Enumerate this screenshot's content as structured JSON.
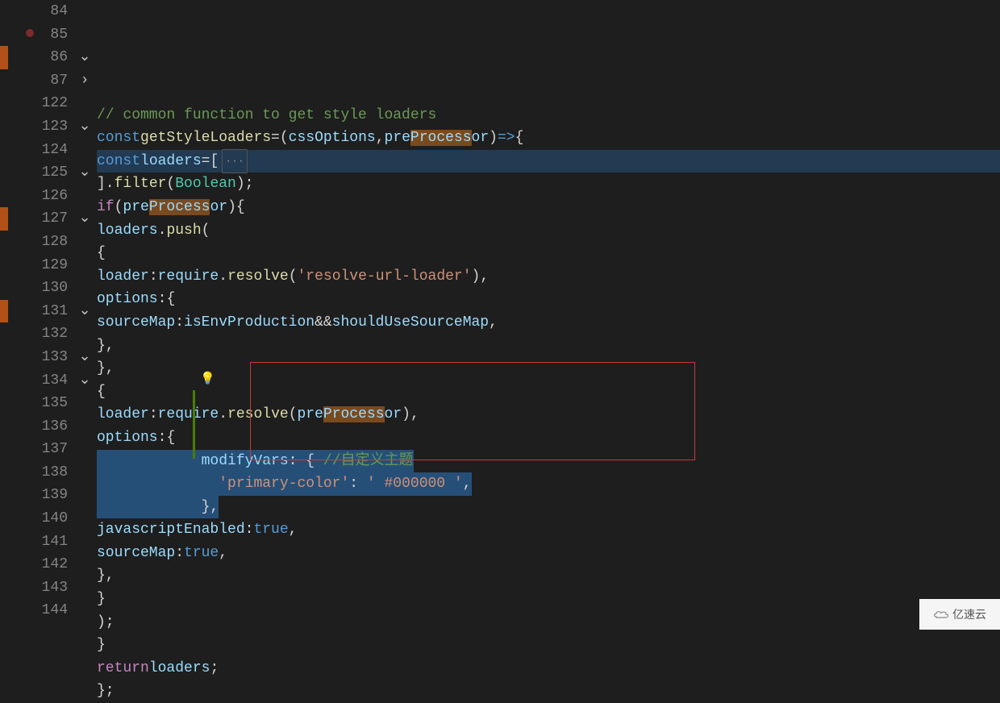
{
  "lines": [
    {
      "num": "84",
      "fold": "",
      "html": ""
    },
    {
      "num": "85",
      "fold": "",
      "html": "  <span class='cmt'>// common function to get style loaders</span>",
      "breakpoint": true
    },
    {
      "num": "86",
      "fold": "down",
      "html": "  <span class='kw'>const</span> <span class='fn'>getStyleLoaders</span> <span class='op'>=</span> <span class='punct'>(</span><span class='var'>cssOptions</span><span class='punct'>,</span> <span class='var'>pre<span class='match'>Process</span>or</span><span class='punct'>)</span> <span class='kw'>=&gt;</span> <span class='punct'>{</span>"
    },
    {
      "num": "87",
      "fold": "right",
      "html": "    <span class='kw'>const</span> <span class='var'>loaders</span> <span class='op'>=</span> <span class='punct'>[</span><span class='ellipsis'>···</span>",
      "highlight": true
    },
    {
      "num": "122",
      "fold": "",
      "html": "    <span class='punct'>].</span><span class='fn'>filter</span><span class='punct'>(</span><span class='cls'>Boolean</span><span class='punct'>);</span>"
    },
    {
      "num": "123",
      "fold": "down",
      "html": "    <span class='kw2'>if</span> <span class='punct'>(</span><span class='var'>pre<span class='match'>Process</span>or</span><span class='punct'>)</span> <span class='punct'>{</span>"
    },
    {
      "num": "124",
      "fold": "",
      "html": "      <span class='var'>loaders</span><span class='punct'>.</span><span class='fn'>push</span><span class='punct'>(</span>"
    },
    {
      "num": "125",
      "fold": "down",
      "html": "        <span class='punct'>{</span>"
    },
    {
      "num": "126",
      "fold": "",
      "html": "          <span class='var'>loader</span><span class='punct'>:</span> <span class='var'>require</span><span class='punct'>.</span><span class='fn'>resolve</span><span class='punct'>(</span><span class='str'>'resolve-url-loader'</span><span class='punct'>),</span>"
    },
    {
      "num": "127",
      "fold": "down",
      "html": "          <span class='var'>options</span><span class='punct'>:</span> <span class='punct'>{</span>"
    },
    {
      "num": "128",
      "fold": "",
      "html": "            <span class='var'>sourceMap</span><span class='punct'>:</span> <span class='var'>isEnvProduction</span> <span class='op'>&amp;&amp;</span> <span class='var'>shouldUseSourceMap</span><span class='punct'>,</span>"
    },
    {
      "num": "129",
      "fold": "",
      "html": "          <span class='punct'>},</span>"
    },
    {
      "num": "130",
      "fold": "",
      "html": "        <span class='punct'>},</span>"
    },
    {
      "num": "131",
      "fold": "down",
      "html": "        <span class='punct'>{</span>"
    },
    {
      "num": "132",
      "fold": "",
      "html": "          <span class='var'>loader</span><span class='punct'>:</span> <span class='var'>require</span><span class='punct'>.</span><span class='fn'>resolve</span><span class='punct'>(</span><span class='var'>pre<span class='match'>Process</span>or</span><span class='punct'>),</span>"
    },
    {
      "num": "133",
      "fold": "down",
      "html": "          <span class='var'>options</span><span class='punct'>:</span> <span class='punct'>{</span>"
    },
    {
      "num": "134",
      "fold": "down",
      "html": "<span class='sel'>            <span class='var'>modifyVars</span><span class='punct'>:</span> <span class='punct'>{</span> <span class='cmt'>//自定义主题</span></span>"
    },
    {
      "num": "135",
      "fold": "",
      "html": "<span class='sel'>              <span class='str'>'primary-color'</span><span class='punct'>:</span> <span class='str'>' #000000 '</span><span class='punct'>,</span></span>"
    },
    {
      "num": "136",
      "fold": "",
      "html": "<span class='sel'>            <span class='punct'>},</span></span>"
    },
    {
      "num": "137",
      "fold": "",
      "html": "            <span class='var'>javascriptEnabled</span><span class='punct'>:</span> <span class='bool'>true</span><span class='punct'>,</span>"
    },
    {
      "num": "138",
      "fold": "",
      "html": "            <span class='var'>sourceMap</span><span class='punct'>:</span> <span class='bool'>true</span><span class='punct'>,</span>"
    },
    {
      "num": "139",
      "fold": "",
      "html": "          <span class='punct'>},</span>"
    },
    {
      "num": "140",
      "fold": "",
      "html": "        <span class='punct'>}</span>"
    },
    {
      "num": "141",
      "fold": "",
      "html": "      <span class='punct'>);</span>"
    },
    {
      "num": "142",
      "fold": "",
      "html": "    <span class='punct'>}</span>"
    },
    {
      "num": "143",
      "fold": "",
      "html": "    <span class='kw2'>return</span> <span class='var'>loaders</span><span class='punct'>;</span>"
    },
    {
      "num": "144",
      "fold": "",
      "html": "  <span class='punct'>};</span>"
    }
  ],
  "activity": [
    {
      "bg": ""
    },
    {
      "bg": ""
    },
    {
      "bg": "act-orange"
    },
    {
      "bg": ""
    },
    {
      "bg": ""
    },
    {
      "bg": ""
    },
    {
      "bg": ""
    },
    {
      "bg": ""
    },
    {
      "bg": ""
    },
    {
      "bg": "act-orange"
    },
    {
      "bg": ""
    },
    {
      "bg": ""
    },
    {
      "bg": ""
    },
    {
      "bg": "act-orange"
    },
    {
      "bg": ""
    },
    {
      "bg": ""
    },
    {
      "bg": ""
    },
    {
      "bg": ""
    },
    {
      "bg": ""
    },
    {
      "bg": ""
    },
    {
      "bg": ""
    },
    {
      "bg": ""
    },
    {
      "bg": ""
    },
    {
      "bg": ""
    },
    {
      "bg": ""
    },
    {
      "bg": ""
    },
    {
      "bg": ""
    }
  ],
  "watermark": "亿速云"
}
